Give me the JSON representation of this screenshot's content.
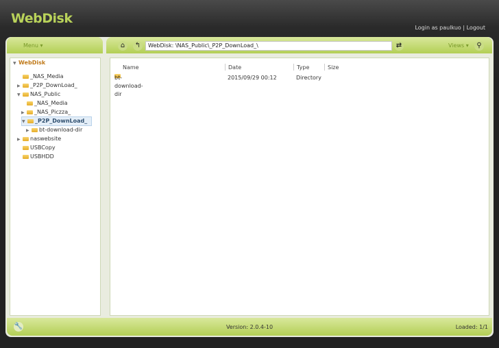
{
  "app": {
    "title": "WebDisk",
    "login_text": "Login as paulkuo",
    "separator": "|",
    "logout": "Logout"
  },
  "toolbar": {
    "menu": "Menu",
    "path": "WebDisk: \\NAS_Public\\_P2P_DownLoad_\\",
    "views": "Views"
  },
  "tree": {
    "root": "WebDisk",
    "nodes": [
      {
        "label": "_NAS_Media"
      },
      {
        "label": "_P2P_DownLoad_"
      },
      {
        "label": "NAS_Public"
      },
      {
        "label": "_NAS_Media"
      },
      {
        "label": "_NAS_Piczza_"
      },
      {
        "label": "_P2P_DownLoad_"
      },
      {
        "label": "bt-download-dir"
      },
      {
        "label": "naswebsite"
      },
      {
        "label": "USBCopy"
      },
      {
        "label": "USBHDD"
      }
    ]
  },
  "list": {
    "columns": [
      "Name",
      "Date",
      "Type",
      "Size"
    ],
    "rows": [
      {
        "name": "bt-download-dir",
        "date": "2015/09/29 00:12",
        "type": "Directory",
        "size": ""
      }
    ]
  },
  "footer": {
    "version": "Version: 2.0.4-10",
    "loaded": "Loaded: 1/1"
  }
}
